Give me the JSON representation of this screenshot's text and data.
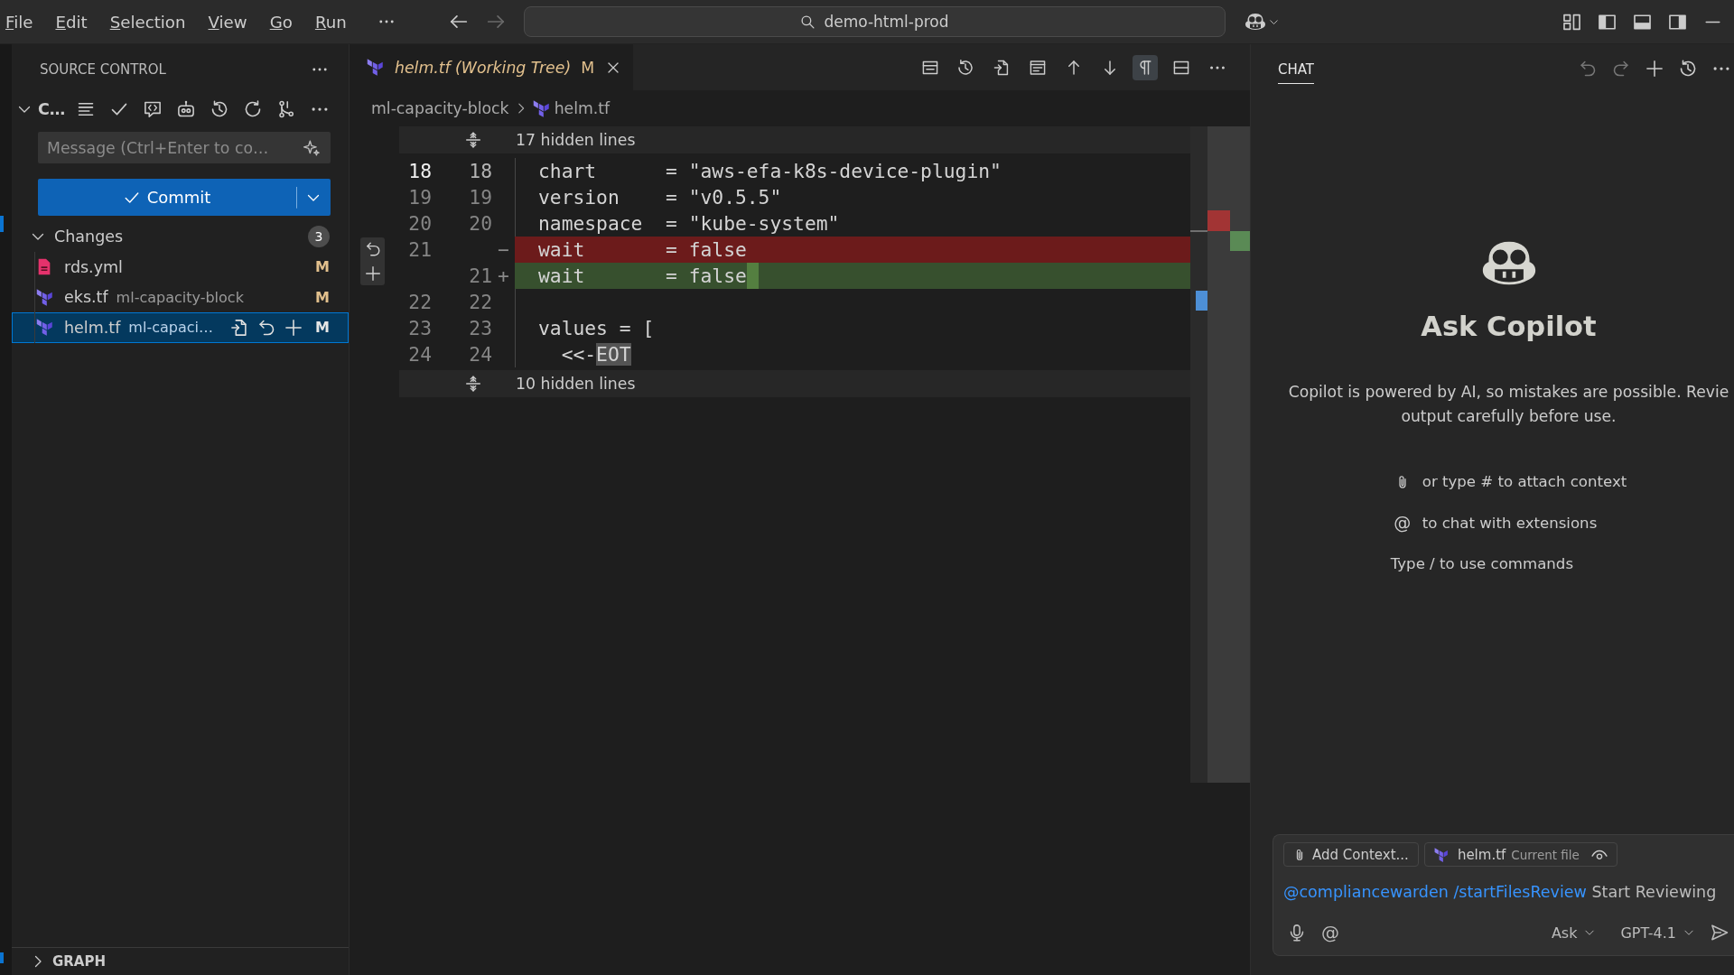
{
  "title_bar": {
    "menu": [
      "File",
      "Edit",
      "Selection",
      "View",
      "Go",
      "Run"
    ],
    "navigation": {
      "back_disabled": false,
      "forward_disabled": true
    },
    "command_center": {
      "label": "demo-html-prod"
    }
  },
  "sidebar": {
    "title": "SOURCE CONTROL",
    "repository": {
      "name": "C…",
      "expanded": true
    },
    "commit_message": {
      "placeholder": "Message (Ctrl+Enter to co…"
    },
    "commit_button": {
      "label": "Commit"
    },
    "changes": {
      "label": "Changes",
      "count": "3",
      "expanded": true,
      "files": [
        {
          "name": "rds.yml",
          "kind": "yaml",
          "status": "M",
          "selected": false
        },
        {
          "name": "eks.tf",
          "folder": "ml-capacity-block",
          "kind": "terraform",
          "status": "M",
          "selected": false
        },
        {
          "name": "helm.tf",
          "folder": "ml-capaci…",
          "kind": "terraform",
          "status": "M",
          "selected": true
        }
      ]
    },
    "graph": {
      "label": "GRAPH",
      "expanded": false
    }
  },
  "editor": {
    "tab": {
      "title": "helm.tf (Working Tree)",
      "status": "M",
      "kind": "terraform",
      "preview": true
    },
    "toolbar": [
      {
        "kind": "layout",
        "selected": false
      },
      {
        "kind": "history",
        "selected": false
      },
      {
        "kind": "open",
        "selected": false
      },
      {
        "kind": "inline",
        "selected": false
      },
      {
        "kind": "previous",
        "selected": false
      },
      {
        "kind": "next",
        "selected": false
      },
      {
        "kind": "whitespace",
        "selected": true
      },
      {
        "kind": "split",
        "selected": false
      },
      {
        "kind": "more",
        "selected": false
      }
    ],
    "breadcrumb": [
      {
        "label": "ml-capacity-block",
        "kind": "folder"
      },
      {
        "label": "helm.tf",
        "kind": "terraform"
      }
    ],
    "diff": {
      "hidden_above": "17 hidden lines",
      "lines": [
        {
          "old": "18",
          "new": "18",
          "kind": "context",
          "current": true,
          "trailing_change": false,
          "segments": [
            {
              "text": "chart      = \"aws-efa-k8s-device-plugin\"",
              "highlighted": false
            }
          ]
        },
        {
          "old": "19",
          "new": "19",
          "kind": "context",
          "current": false,
          "trailing_change": false,
          "segments": [
            {
              "text": "version    = \"v0.5.5\"",
              "highlighted": false
            }
          ]
        },
        {
          "old": "20",
          "new": "20",
          "kind": "context",
          "current": false,
          "trailing_change": false,
          "segments": [
            {
              "text": "namespace  = \"kube-system\"",
              "highlighted": false
            }
          ]
        },
        {
          "old": "21",
          "marker": "−",
          "kind": "removed",
          "current": false,
          "trailing_change": false,
          "segments": [
            {
              "text": "wait       = false",
              "highlighted": false
            }
          ]
        },
        {
          "new": "21",
          "marker": "+",
          "kind": "added",
          "current": false,
          "trailing_change": true,
          "segments": [
            {
              "text": "wait       = false",
              "highlighted": false
            }
          ]
        },
        {
          "old": "22",
          "new": "22",
          "kind": "context",
          "current": false,
          "trailing_change": false
        },
        {
          "old": "23",
          "new": "23",
          "kind": "context",
          "current": false,
          "trailing_change": false,
          "segments": [
            {
              "text": "values = [",
              "highlighted": false
            }
          ]
        },
        {
          "old": "24",
          "new": "24",
          "kind": "context",
          "current": false,
          "trailing_change": false,
          "segments": [
            {
              "text": "  <<-",
              "highlighted": false
            },
            {
              "text": "EOT",
              "highlighted": true
            }
          ]
        }
      ],
      "hidden_below": "10 hidden lines"
    }
  },
  "chat": {
    "tabs": [
      {
        "label": "CHAT",
        "selected": true
      }
    ],
    "actions": [
      {
        "kind": "undo",
        "disabled": true
      },
      {
        "kind": "redo",
        "disabled": true
      },
      {
        "kind": "new",
        "disabled": false
      },
      {
        "kind": "history",
        "disabled": false
      },
      {
        "kind": "more",
        "disabled": false
      }
    ],
    "welcome": {
      "title": "Ask Copilot",
      "description": [
        "Copilot is powered by AI, so mistakes are possible. Revie",
        "output carefully before use."
      ],
      "hints": [
        {
          "kind": "attach",
          "text": "or type # to attach context"
        },
        {
          "kind": "mention",
          "symbol": "@",
          "text": "to chat with extensions"
        },
        {
          "kind": "plain",
          "text": "Type / to use commands"
        }
      ]
    },
    "input": {
      "context": [
        {
          "kind": "attach",
          "label": "Add Context..."
        },
        {
          "kind": "terraform",
          "label": "helm.tf",
          "detail": "Current file"
        }
      ],
      "value": [
        {
          "kind": "agent",
          "text": "@compliancewarden"
        },
        {
          "kind": "command",
          "text": "/startFilesReview"
        },
        {
          "kind": "plain",
          "text": "Start Reviewing"
        }
      ],
      "mention": "@",
      "mode": "Ask",
      "model": "GPT-4.1"
    }
  }
}
